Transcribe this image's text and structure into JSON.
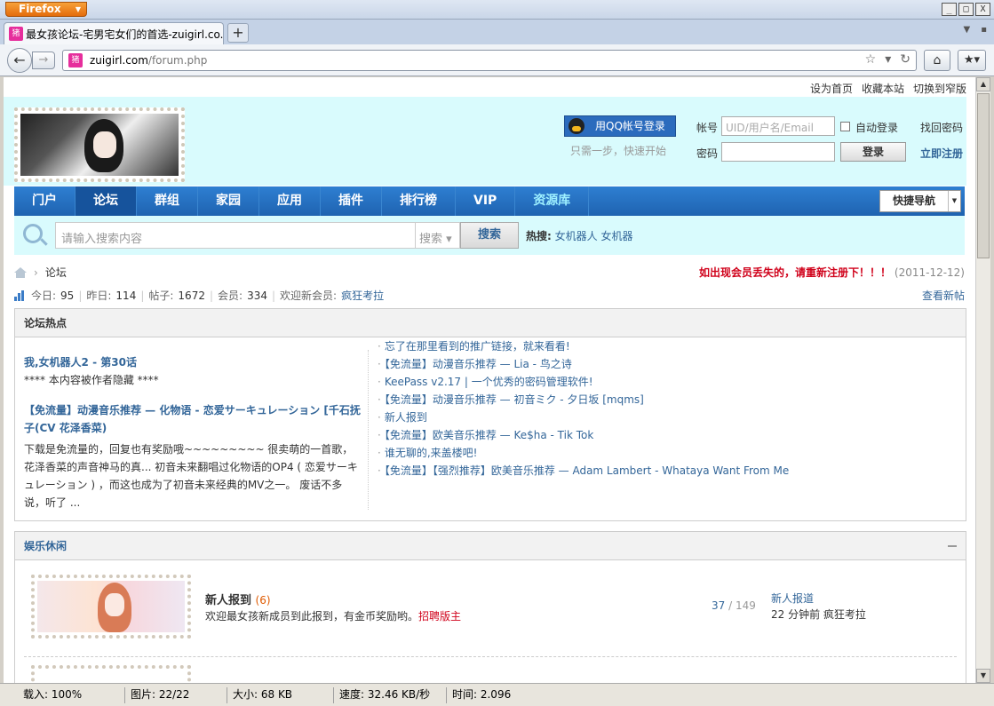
{
  "browser": {
    "menu_button": "Firefox",
    "tab_title": "最女孩论坛-宅男宅女们的首选-zuigirl.co...",
    "favicon_text": "猪",
    "new_tab": "+",
    "url_host": "zuigirl.com",
    "url_path": "/forum.php",
    "win_min": "_",
    "win_max": "□",
    "win_close": "X"
  },
  "topnav": [
    "设为首页",
    "收藏本站",
    "切换到窄版"
  ],
  "login": {
    "qq_button": "用QQ帐号登录",
    "qq_hint": "只需一步，快速开始",
    "account_label": "帐号",
    "account_placeholder": "UID/用户名/Email",
    "auto_login": "自动登录",
    "forgot": "找回密码",
    "password_label": "密码",
    "login_button": "登录",
    "register": "立即注册"
  },
  "mainnav": {
    "items": [
      "门户",
      "论坛",
      "群组",
      "家园",
      "应用",
      "插件",
      "排行榜",
      "VIP",
      "资源库"
    ],
    "quick_nav": "快捷导航"
  },
  "search": {
    "placeholder": "请输入搜索内容",
    "type": "搜索",
    "button": "搜索",
    "hot_label": "热搜:",
    "hot_items": [
      "女机器人",
      "女机器"
    ]
  },
  "breadcrumb": {
    "current": "论坛",
    "sep": "›"
  },
  "notice": {
    "text": "如出现会员丢失的，请重新注册下！！！",
    "date": "(2011-12-12)"
  },
  "stats": {
    "today_label": "今日:",
    "today": "95",
    "yesterday_label": "昨日:",
    "yesterday": "114",
    "posts_label": "帖子:",
    "posts": "1672",
    "members_label": "会员:",
    "members": "334",
    "welcome_label": "欢迎新会员:",
    "new_member": "疯狂考拉",
    "new_posts": "查看新帖"
  },
  "hot": {
    "title": "论坛热点",
    "left": [
      {
        "title": "我,女机器人2 - 第30话",
        "desc": "**** 本内容被作者隐藏 ****"
      },
      {
        "title": "【免流量】动漫音乐推荐 — 化物语 - 恋爱サーキュレーション [千石抚子(CV 花泽香菜)",
        "desc": "下载是免流量的，回复也有奖励哦~~~~~~~~~ 很卖萌的一首歌，花泽香菜的声音神马的真... 初音未来翻唱过化物语的OP4 ( 恋爱サーキュレーション ) ，而这也成为了初音未来经典的MV之一。 废话不多说，听了 ..."
      }
    ],
    "right": [
      "忘了在那里看到的推广链接，就来看看!",
      "【免流量】动漫音乐推荐 — Lia - 鸟之诗",
      "KeePass v2.17 | 一个优秀的密码管理软件!",
      "【免流量】动漫音乐推荐 — 初音ミク - 夕日坂 [mqms]",
      "新人报到",
      "【免流量】欧美音乐推荐 — Ke$ha - Tik Tok",
      "谁无聊的,来盖楼吧!",
      "【免流量】【强烈推荐】欧美音乐推荐 — Adam Lambert - Whataya Want From Me"
    ]
  },
  "category": {
    "title": "娱乐休闲",
    "forum": {
      "name": "新人报到",
      "count": "(6)",
      "desc": "欢迎最女孩新成员到此报到，有金币奖励哟。",
      "moderator": "招聘版主",
      "threads": "37",
      "stat_sep": "/",
      "posts": "149",
      "last_title": "新人报道",
      "last_time": "22 分钟前",
      "last_user": "疯狂考拉"
    }
  },
  "statusbar": {
    "load": "载入: 100%",
    "images": "图片: 22/22",
    "size": "大小: 68 KB",
    "speed": "速度: 32.46 KB/秒",
    "time": "时间: 2.096"
  }
}
